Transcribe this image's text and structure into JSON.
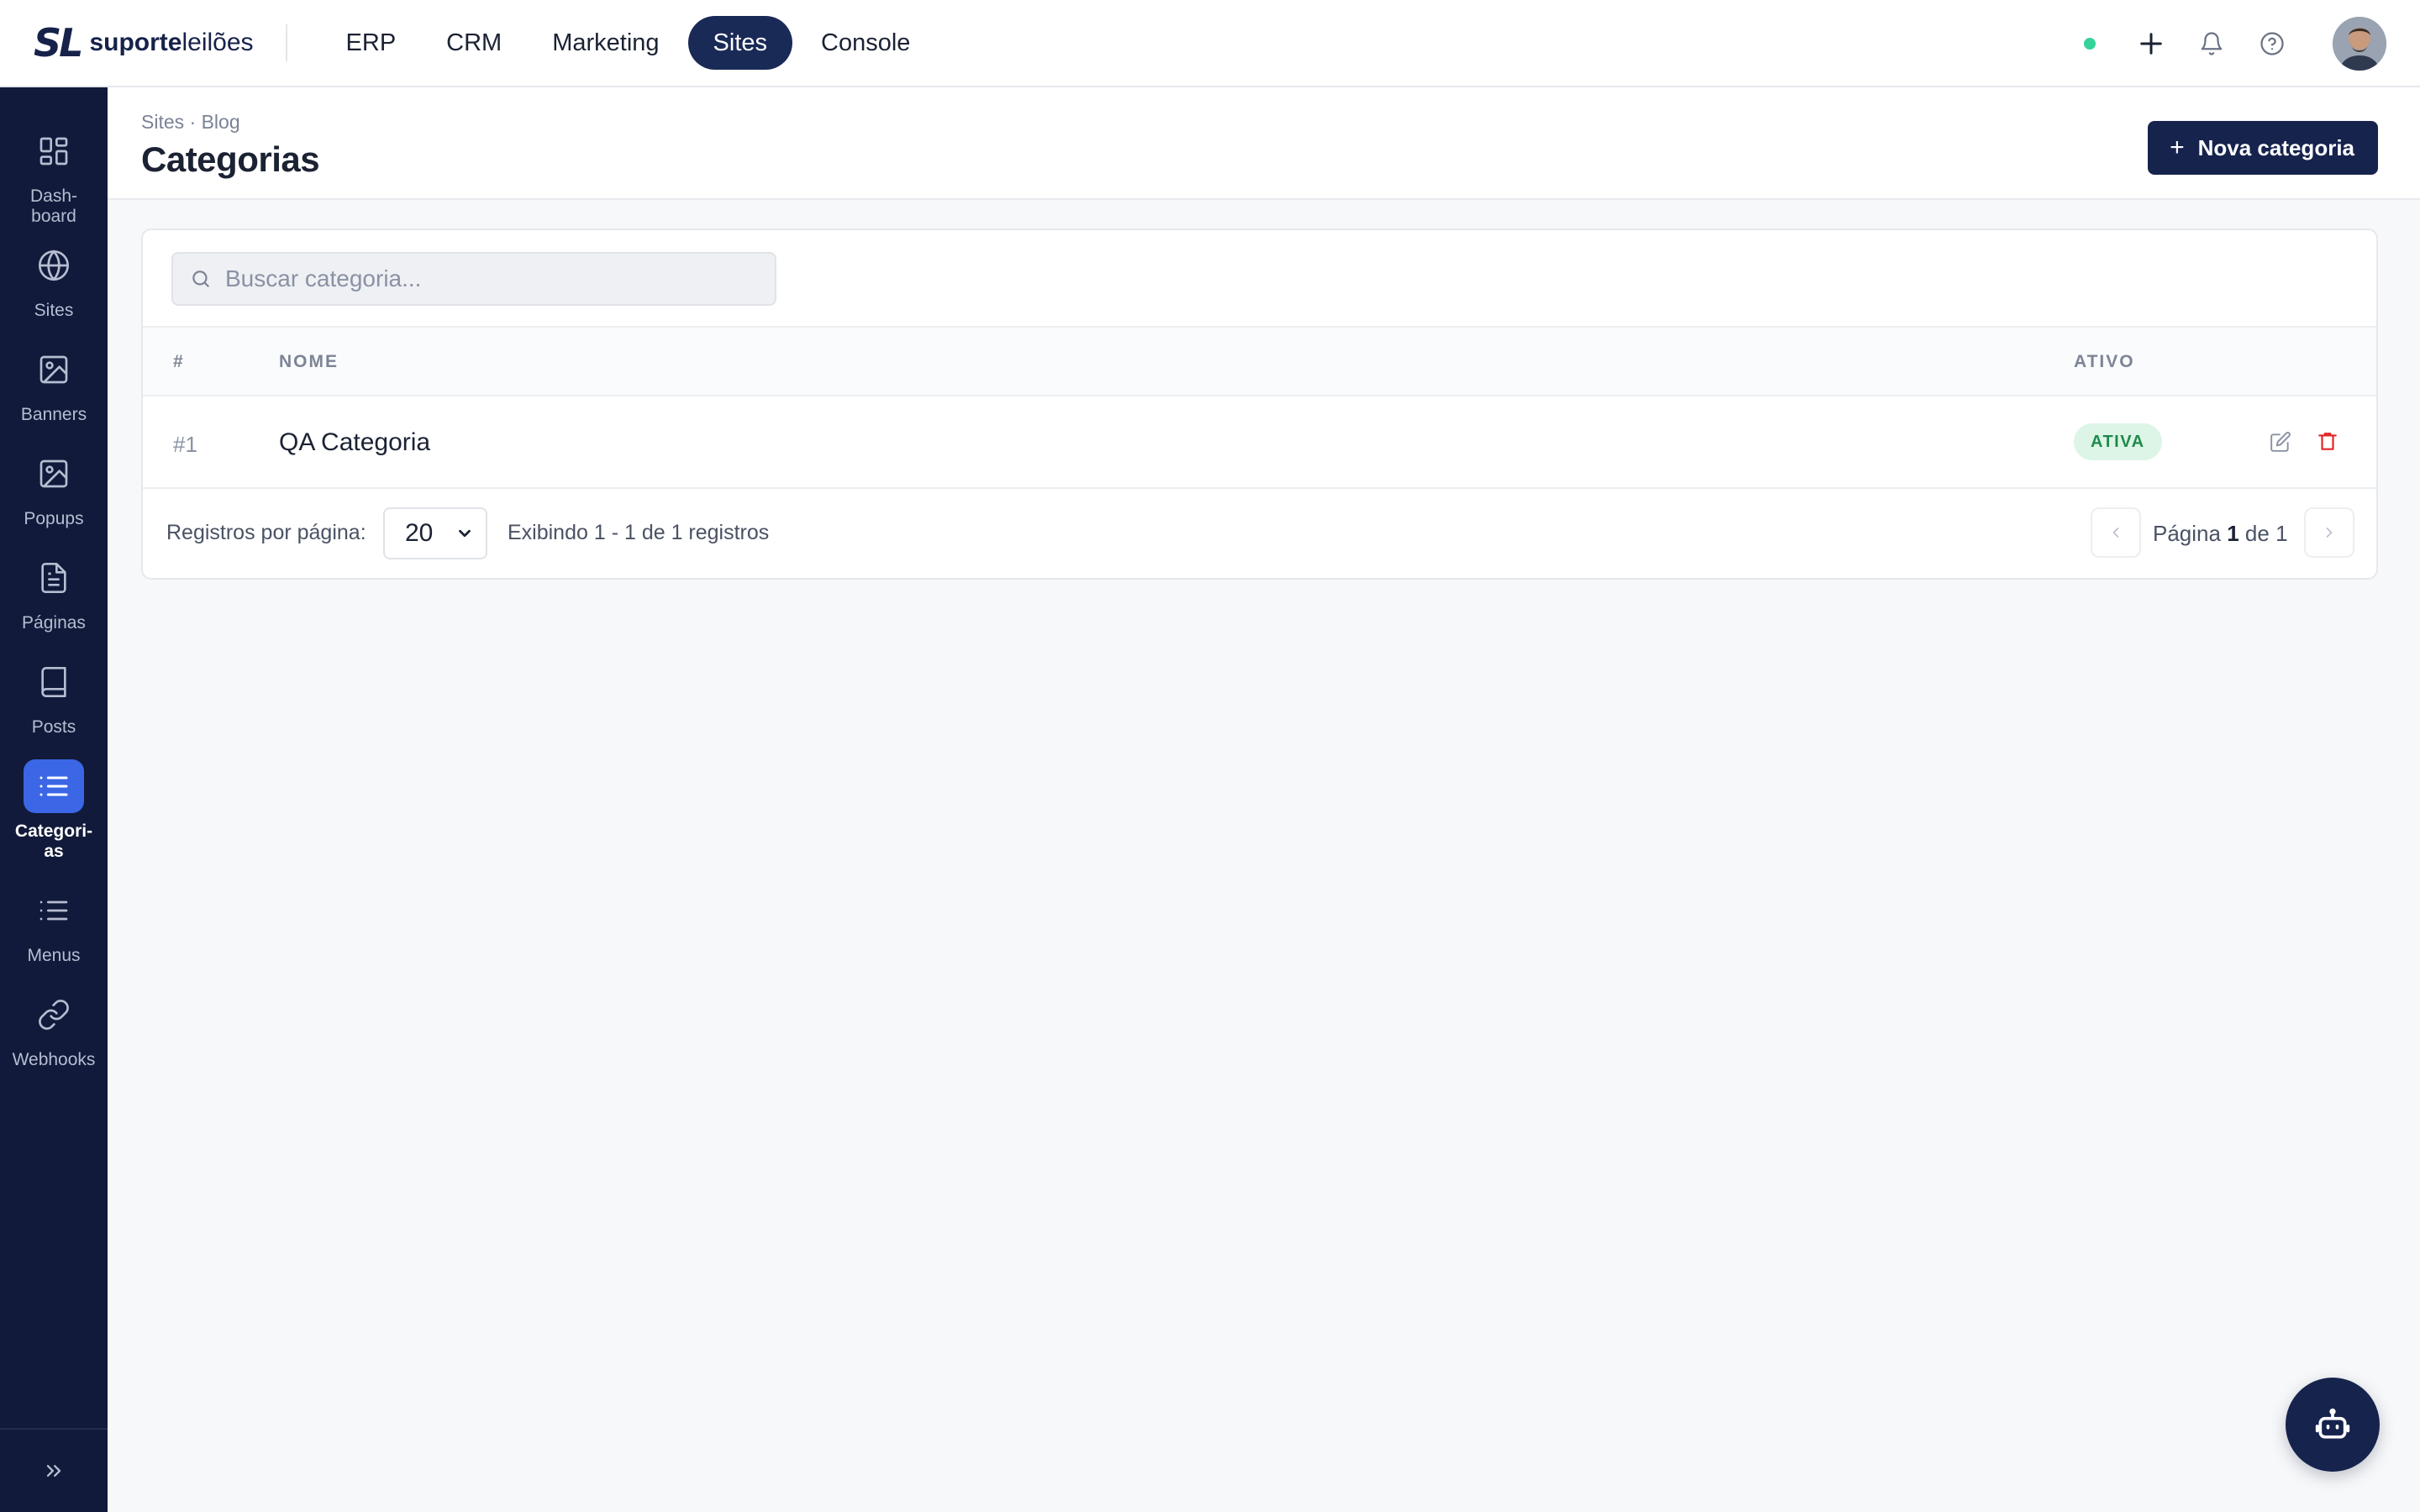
{
  "brand": {
    "mark": "SL",
    "name_bold": "suporte",
    "name_light": "leilões"
  },
  "topnav": {
    "items": [
      {
        "label": "ERP",
        "active": false
      },
      {
        "label": "CRM",
        "active": false
      },
      {
        "label": "Marketing",
        "active": false
      },
      {
        "label": "Sites",
        "active": true
      },
      {
        "label": "Console",
        "active": false
      }
    ],
    "status_color": "#34d399",
    "icons": [
      "plus-icon",
      "bell-icon",
      "help-icon"
    ]
  },
  "sidebar": {
    "items": [
      {
        "label": "Dash-\nboard",
        "icon": "dashboard-icon",
        "active": false
      },
      {
        "label": "Sites",
        "icon": "globe-icon",
        "active": false
      },
      {
        "label": "Banners",
        "icon": "image-icon",
        "active": false
      },
      {
        "label": "Popups",
        "icon": "image-icon",
        "active": false
      },
      {
        "label": "Páginas",
        "icon": "file-icon",
        "active": false
      },
      {
        "label": "Posts",
        "icon": "book-icon",
        "active": false
      },
      {
        "label": "Categori-\nas",
        "icon": "list-icon",
        "active": true
      },
      {
        "label": "Menus",
        "icon": "list-icon",
        "active": false
      },
      {
        "label": "Webhooks",
        "icon": "link-icon",
        "active": false
      }
    ],
    "collapse_icon": "chevrons-right-icon"
  },
  "header": {
    "breadcrumb": "Sites · Blog",
    "title": "Categorias",
    "new_button": "Nova categoria"
  },
  "search": {
    "placeholder": "Buscar categoria...",
    "value": ""
  },
  "table": {
    "columns": {
      "id": "#",
      "name": "NOME",
      "active": "ATIVO"
    },
    "rows": [
      {
        "id": "#1",
        "name": "QA Categoria",
        "status": "ATIVA"
      }
    ]
  },
  "pagination": {
    "per_page_label": "Registros por página:",
    "per_page": "20",
    "showing": "Exibindo 1 - 1 de 1 registros",
    "page_label": "Página",
    "page": "1",
    "of_label": "de",
    "total_pages": "1"
  },
  "colors": {
    "accent": "#15234d",
    "sidebar_bg": "#111a3a",
    "sidebar_active": "#3b67e6",
    "badge_bg": "#dcf5e6",
    "badge_text": "#1f8a4c",
    "delete": "#e02424"
  },
  "fab": {
    "icon": "robot-icon"
  }
}
